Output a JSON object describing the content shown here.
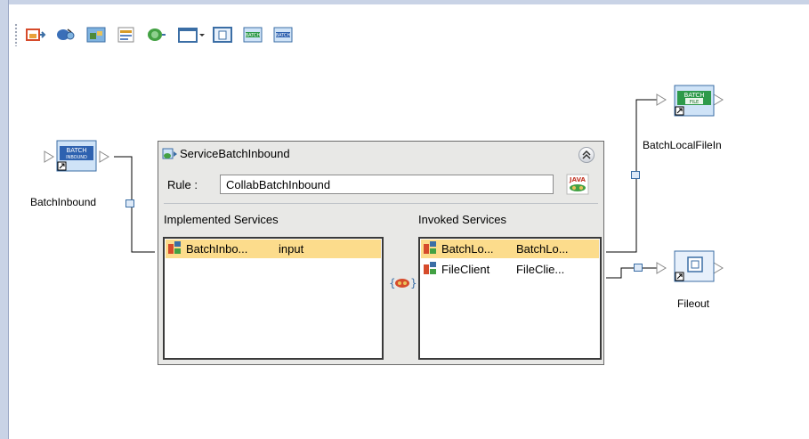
{
  "toolbar": {
    "buttons": [
      {
        "name": "inbound-service-icon",
        "color": "#d64b2b"
      },
      {
        "name": "collaboration-icon",
        "color": "#3a6fb8"
      },
      {
        "name": "image-service-icon",
        "color": "#4e8dc4"
      },
      {
        "name": "properties-icon",
        "color": "#d79b2a"
      },
      {
        "name": "outbound-service-icon",
        "color": "#43a143"
      },
      {
        "name": "window-dropdown-icon",
        "color": "#3b6ea5"
      },
      {
        "name": "file-service-icon",
        "color": "#3b6ea5"
      },
      {
        "name": "batch-icon",
        "color": "#2e9a4a"
      },
      {
        "name": "batch-inbound-icon",
        "color": "#2e62b0"
      }
    ]
  },
  "external": {
    "batch_inbound": {
      "label": "BatchInbound",
      "icon_text": "BATCH",
      "icon_sub": "INBOUND"
    },
    "batch_local_file_in": {
      "label": "BatchLocalFileIn",
      "icon_text": "BATCH",
      "icon_sub": "FILE"
    },
    "file_out": {
      "label": "Fileout"
    }
  },
  "service": {
    "title": "ServiceBatchInbound",
    "rule_label": "Rule :",
    "rule_value": "CollabBatchInbound",
    "java_badge": "JAVA",
    "implemented_header": "Implemented Services",
    "invoked_header": "Invoked Services",
    "implemented": [
      {
        "name": "BatchInbo...",
        "op": "input",
        "selected": true
      }
    ],
    "invoked": [
      {
        "name": "BatchLo...",
        "op": "BatchLo...",
        "selected": true
      },
      {
        "name": "FileClient",
        "op": "FileClie...",
        "selected": false
      }
    ]
  },
  "colors": {
    "accent": "#3b6ea5",
    "selection": "#fcdc8c",
    "panel": "#e8e8e6"
  }
}
